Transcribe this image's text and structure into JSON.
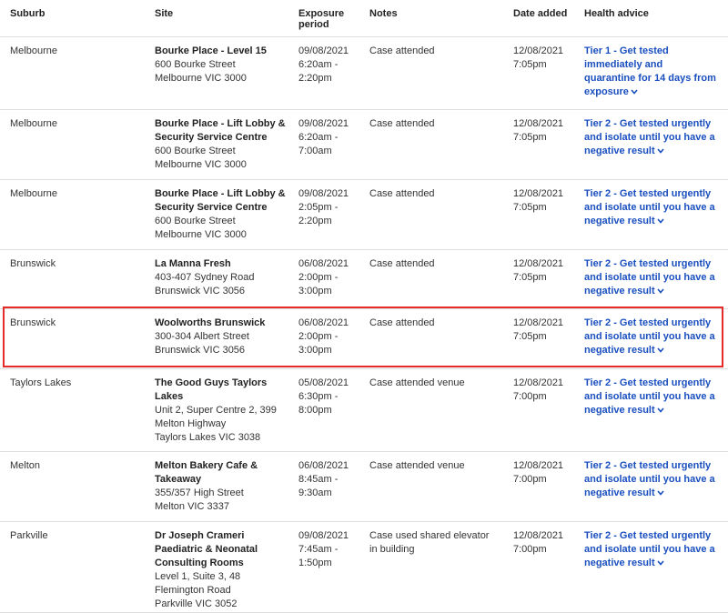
{
  "headers": {
    "suburb": "Suburb",
    "site": "Site",
    "exposure": "Exposure period",
    "notes": "Notes",
    "date": "Date added",
    "advice": "Health advice"
  },
  "colors": {
    "link": "#1a4fbf",
    "highlight": "#e62b2b",
    "divider": "#dddddd"
  },
  "rows": [
    {
      "suburb": "Melbourne",
      "site_name": [
        "Bourke Place - Level 15"
      ],
      "address": [
        "600 Bourke Street",
        "Melbourne VIC 3000"
      ],
      "exposure": [
        "09/08/2021",
        "6:20am -",
        "2:20pm"
      ],
      "notes": [
        "Case attended"
      ],
      "date": [
        "12/08/2021",
        "7:05pm"
      ],
      "advice": [
        "Tier 1 - Get tested",
        "immediately and",
        "quarantine for 14 days from",
        "exposure"
      ]
    },
    {
      "suburb": "Melbourne",
      "site_name": [
        "Bourke Place - Lift Lobby &",
        "Security Service Centre"
      ],
      "address": [
        "600 Bourke Street",
        "Melbourne VIC 3000"
      ],
      "exposure": [
        "09/08/2021",
        "6:20am -",
        "7:00am"
      ],
      "notes": [
        "Case attended"
      ],
      "date": [
        "12/08/2021",
        "7:05pm"
      ],
      "advice": [
        "Tier 2 - Get tested urgently",
        "and isolate until you have a",
        "negative result"
      ]
    },
    {
      "suburb": "Melbourne",
      "site_name": [
        "Bourke Place - Lift Lobby &",
        "Security Service Centre"
      ],
      "address": [
        "600 Bourke Street",
        "Melbourne VIC 3000"
      ],
      "exposure": [
        "09/08/2021",
        "2:05pm -",
        "2:20pm"
      ],
      "notes": [
        "Case attended"
      ],
      "date": [
        "12/08/2021",
        "7:05pm"
      ],
      "advice": [
        "Tier 2 - Get tested urgently",
        "and isolate until you have a",
        "negative result"
      ]
    },
    {
      "suburb": "Brunswick",
      "site_name": [
        "La Manna Fresh"
      ],
      "address": [
        "403-407 Sydney Road",
        "Brunswick VIC 3056"
      ],
      "exposure": [
        "06/08/2021",
        "2:00pm -",
        "3:00pm"
      ],
      "notes": [
        "Case attended"
      ],
      "date": [
        "12/08/2021",
        "7:05pm"
      ],
      "advice": [
        "Tier 2 - Get tested urgently",
        "and isolate until you have a",
        "negative result"
      ]
    },
    {
      "suburb": "Brunswick",
      "site_name": [
        "Woolworths Brunswick"
      ],
      "address": [
        "300-304 Albert Street",
        "Brunswick VIC 3056"
      ],
      "exposure": [
        "06/08/2021",
        "2:00pm -",
        "3:00pm"
      ],
      "notes": [
        "Case attended"
      ],
      "date": [
        "12/08/2021",
        "7:05pm"
      ],
      "advice": [
        "Tier 2 - Get tested urgently",
        "and isolate until you have a",
        "negative result"
      ]
    },
    {
      "suburb": "Taylors Lakes",
      "site_name": [
        "The Good Guys Taylors",
        "Lakes"
      ],
      "address": [
        "Unit 2, Super Centre 2, 399",
        "Melton Highway",
        "Taylors Lakes VIC 3038"
      ],
      "exposure": [
        "05/08/2021",
        "6:30pm -",
        "8:00pm"
      ],
      "notes": [
        "Case attended venue"
      ],
      "date": [
        "12/08/2021",
        "7:00pm"
      ],
      "advice": [
        "Tier 2 - Get tested urgently",
        "and isolate until you have a",
        "negative result"
      ]
    },
    {
      "suburb": "Melton",
      "site_name": [
        "Melton Bakery Cafe &",
        "Takeaway"
      ],
      "address": [
        "355/357 High Street",
        "Melton VIC 3337"
      ],
      "exposure": [
        "06/08/2021",
        "8:45am -",
        "9:30am"
      ],
      "notes": [
        "Case attended venue"
      ],
      "date": [
        "12/08/2021",
        "7:00pm"
      ],
      "advice": [
        "Tier 2 - Get tested urgently",
        "and isolate until you have a",
        "negative result"
      ]
    },
    {
      "suburb": "Parkville",
      "site_name": [
        "Dr Joseph Crameri",
        "Paediatric & Neonatal",
        "Consulting Rooms"
      ],
      "address": [
        "Level 1, Suite 3, 48",
        "Flemington Road",
        "Parkville VIC 3052"
      ],
      "exposure": [
        "09/08/2021",
        "7:45am -",
        "1:50pm"
      ],
      "notes": [
        "Case used shared elevator",
        "in building"
      ],
      "date": [
        "12/08/2021",
        "7:00pm"
      ],
      "advice": [
        "Tier 2 - Get tested urgently",
        "and isolate until you have a",
        "negative result"
      ]
    }
  ]
}
